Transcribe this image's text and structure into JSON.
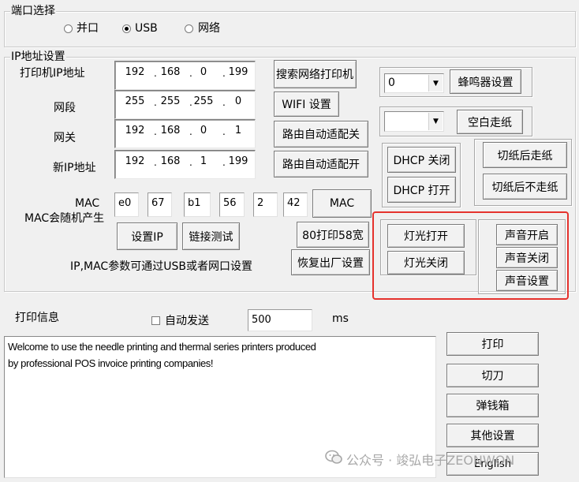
{
  "port_group": {
    "title": "端口选择",
    "options": [
      {
        "label": "并口",
        "selected": false
      },
      {
        "label": "USB",
        "selected": true
      },
      {
        "label": "网络",
        "selected": false
      }
    ]
  },
  "ip_group": {
    "title": "IP地址设置",
    "printer_ip_label": "打印机IP地址",
    "printer_ip": [
      "192",
      "168",
      "0",
      "199"
    ],
    "subnet_label": "网段",
    "subnet": [
      "255",
      "255",
      "255",
      "0"
    ],
    "gateway_label": "网关",
    "gateway": [
      "192",
      "168",
      "0",
      "1"
    ],
    "new_ip_label": "新IP地址",
    "new_ip": [
      "192",
      "168",
      "1",
      "199"
    ],
    "mac_label": "MAC",
    "mac_note": "MAC会随机产生",
    "mac": [
      "e0",
      "67",
      "b1",
      "56",
      "2",
      "42"
    ],
    "note": "IP,MAC参数可通过USB或者网口设置"
  },
  "buttons": {
    "search_printer": "搜索网络打印机",
    "wifi": "WIFI 设置",
    "route_auto_off": "路由自动适配关",
    "route_auto_on": "路由自动适配开",
    "mac": "MAC",
    "set_ip": "设置IP",
    "link_test": "链接测试",
    "print80_58": "80打印58宽",
    "factory_reset": "恢复出厂设置",
    "buzzer": "蜂鸣器设置",
    "blank_feed": "空白走纸",
    "dhcp_off": "DHCP 关闭",
    "dhcp_on": "DHCP 打开",
    "feed_after_cut": "切纸后走纸",
    "no_feed_after_cut": "切纸后不走纸",
    "light_on": "灯光打开",
    "light_off": "灯光关闭",
    "sound_on": "声音开启",
    "sound_off": "声音关闭",
    "sound_settings": "声音设置",
    "print": "打印",
    "cut": "切刀",
    "cash_drawer": "弹钱箱",
    "other_settings": "其他设置",
    "english": "English"
  },
  "combos": {
    "buzzer_value": "0",
    "blank_value": ""
  },
  "print_info": {
    "label": "打印信息",
    "auto_send_label": "自动发送",
    "interval_value": "500",
    "interval_unit": "ms",
    "text_line1": "Welcome to use the needle printing and thermal series printers produced",
    "text_line2": "by professional POS invoice printing companies!"
  },
  "watermark": "公众号 · 竣弘电子ZEONWON",
  "colors": {
    "highlight_box": "#e5322d"
  }
}
